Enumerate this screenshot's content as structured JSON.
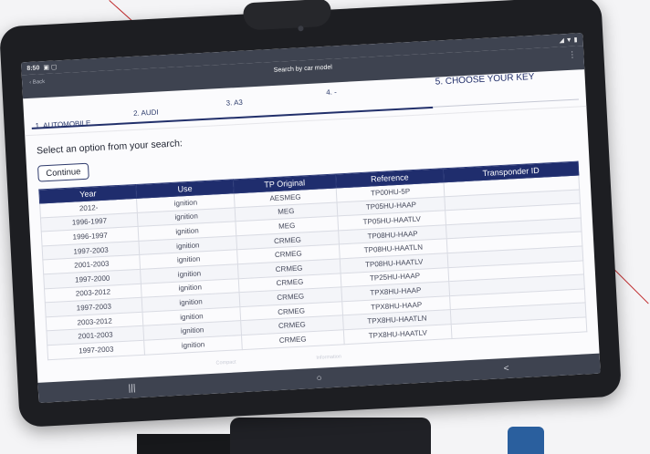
{
  "status": {
    "time": "8:50",
    "left_icons": "▣ ▢",
    "right_icons": "◢ ▼ ▮"
  },
  "appbar": {
    "back_label": "Back",
    "title": "Search by car model",
    "menu_icon": "⋮"
  },
  "steps": [
    {
      "label": "1. AUTOMOBILE"
    },
    {
      "label": "2. AUDI"
    },
    {
      "label": "3. A3"
    },
    {
      "label": "4. -"
    },
    {
      "label": "5. CHOOSE YOUR KEY"
    }
  ],
  "prompt": "Select an option from your search:",
  "continue_label": "Continue",
  "table": {
    "headers": [
      "Year",
      "Use",
      "TP Original",
      "Reference",
      "Transponder ID"
    ],
    "rows": [
      [
        "2012-",
        "ignition",
        "AESMEG",
        "TP00HU-5P",
        ""
      ],
      [
        "1996-1997",
        "ignition",
        "MEG",
        "TP05HU-HAAP",
        ""
      ],
      [
        "1996-1997",
        "ignition",
        "MEG",
        "TP05HU-HAATLV",
        ""
      ],
      [
        "1997-2003",
        "ignition",
        "CRMEG",
        "TP08HU-HAAP",
        ""
      ],
      [
        "2001-2003",
        "ignition",
        "CRMEG",
        "TP08HU-HAATLN",
        ""
      ],
      [
        "1997-2000",
        "ignition",
        "CRMEG",
        "TP08HU-HAATLV",
        ""
      ],
      [
        "2003-2012",
        "ignition",
        "CRMEG",
        "TP25HU-HAAP",
        ""
      ],
      [
        "1997-2003",
        "ignition",
        "CRMEG",
        "TPX8HU-HAAP",
        ""
      ],
      [
        "2003-2012",
        "ignition",
        "CRMEG",
        "TPX8HU-HAAP",
        ""
      ],
      [
        "2001-2003",
        "ignition",
        "CRMEG",
        "TPX8HU-HAATLN",
        ""
      ],
      [
        "1997-2003",
        "ignition",
        "CRMEG",
        "TPX8HU-HAATLV",
        ""
      ]
    ]
  },
  "overlay": {
    "left": "Compact",
    "right": "Information"
  },
  "navbar": {
    "recents_icon": "|||",
    "home_icon": "○",
    "back_icon": "<"
  },
  "colors": {
    "header_bg": "#1f2d6d",
    "bar_bg": "#3e4350",
    "accent": "#22306b"
  }
}
